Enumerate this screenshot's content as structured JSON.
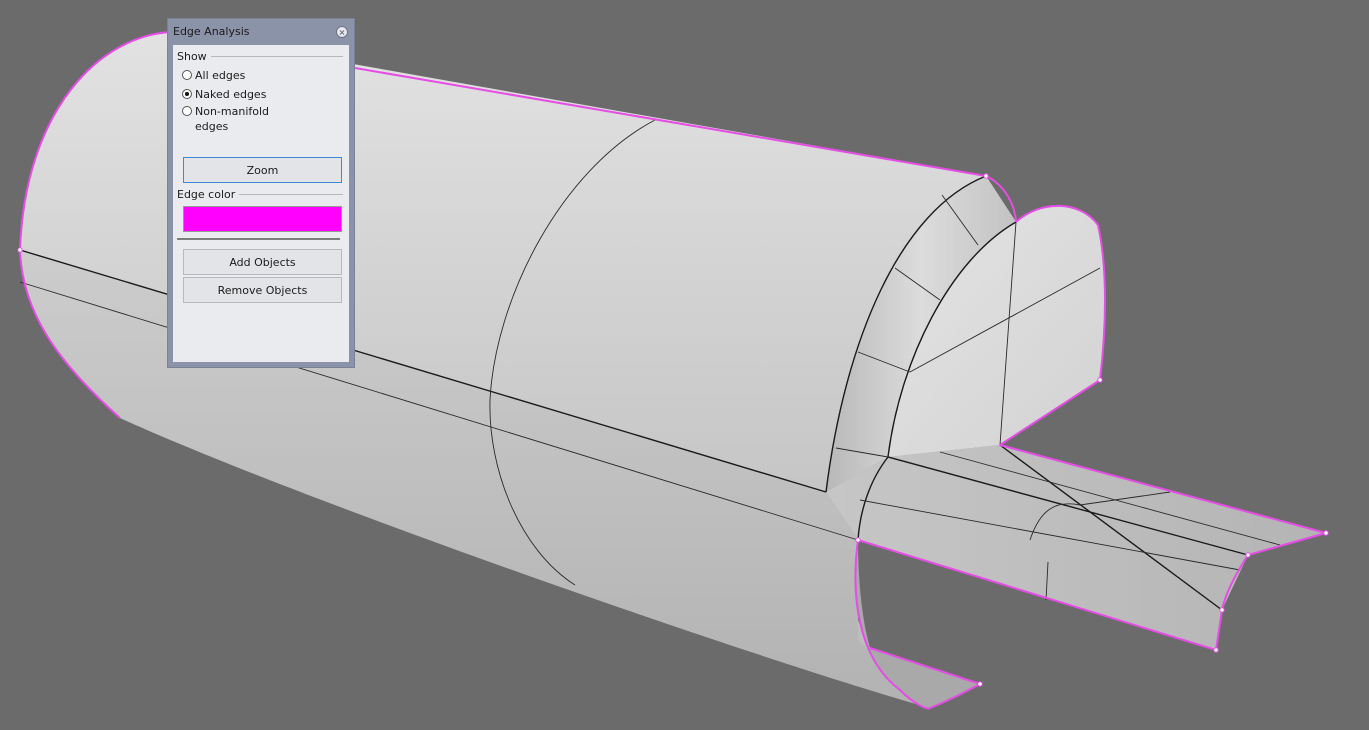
{
  "panel": {
    "title": "Edge Analysis",
    "show_label": "Show",
    "options": [
      {
        "label": "All edges",
        "checked": false
      },
      {
        "label": "Naked edges",
        "checked": true
      },
      {
        "label": "Non-manifold edges",
        "checked": false
      }
    ],
    "option_non_manifold_line1": "Non-manifold",
    "option_non_manifold_line2": "edges",
    "zoom_label": "Zoom",
    "edge_color_label": "Edge color",
    "edge_color": "#ff00ff",
    "add_objects_label": "Add Objects",
    "remove_objects_label": "Remove Objects"
  },
  "viewport": {
    "background": "#6b6b6b",
    "naked_edge_color": "#e64ce6"
  }
}
